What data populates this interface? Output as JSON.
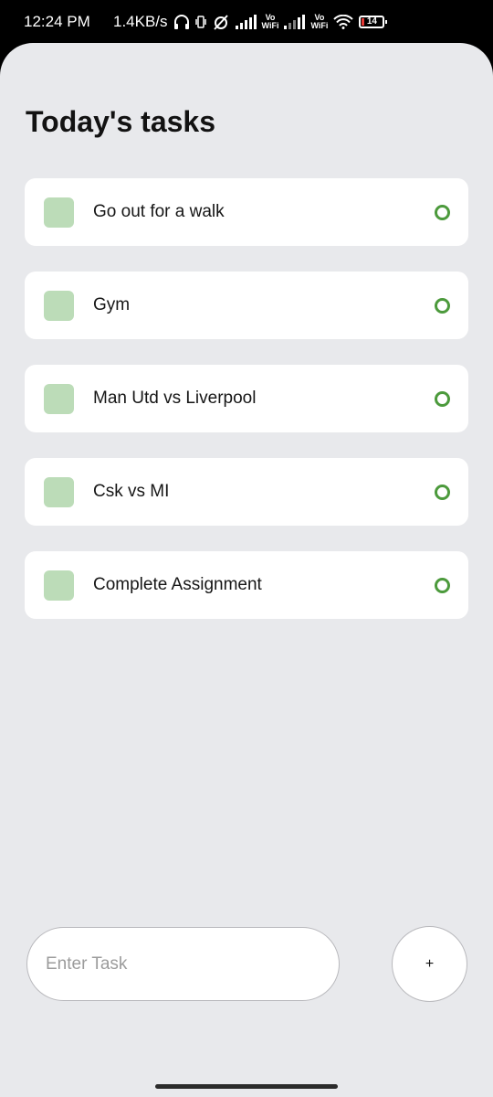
{
  "status_bar": {
    "time": "12:24 PM",
    "network_speed": "1.4KB/s",
    "vowifi_top": "Vo",
    "vowifi_bottom": "WiFi",
    "battery": "14"
  },
  "header": {
    "title": "Today's tasks"
  },
  "tasks": [
    {
      "label": "Go out for a walk"
    },
    {
      "label": "Gym"
    },
    {
      "label": "Man Utd vs Liverpool"
    },
    {
      "label": "Csk vs MI"
    },
    {
      "label": "Complete Assignment"
    }
  ],
  "input": {
    "placeholder": "Enter Task",
    "value": ""
  },
  "add_button": {
    "label": "+"
  },
  "colors": {
    "background": "#e8e9ec",
    "card": "#ffffff",
    "checkbox": "#bcdcb8",
    "circle": "#4c9a3c"
  }
}
